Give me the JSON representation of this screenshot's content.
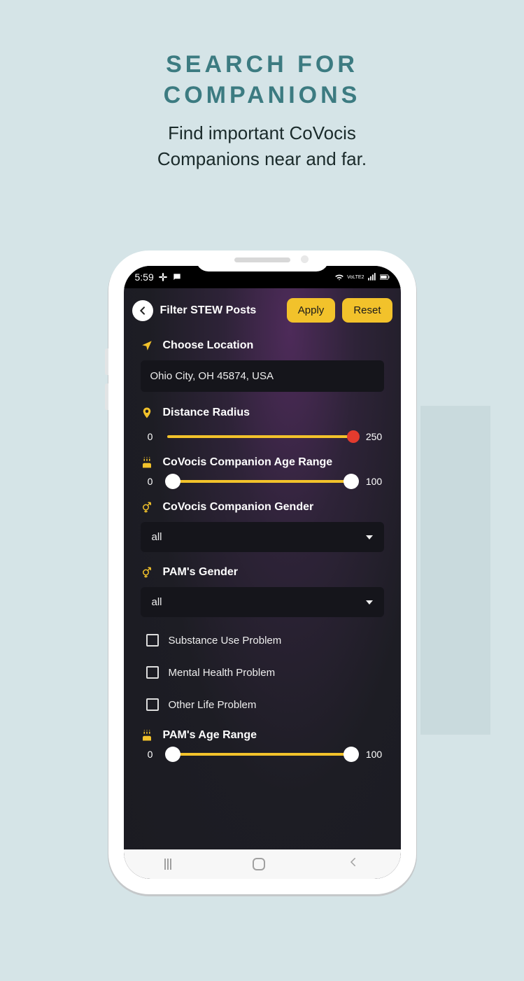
{
  "page": {
    "title_line1": "SEARCH FOR",
    "title_line2": "COMPANIONS",
    "subtitle_line1": "Find important CoVocis",
    "subtitle_line2": "Companions near and far."
  },
  "statusbar": {
    "time": "5:59",
    "carrier": "VoLTE2"
  },
  "appbar": {
    "title": "Filter STEW Posts",
    "apply": "Apply",
    "reset": "Reset"
  },
  "location": {
    "label": "Choose Location",
    "value": "Ohio City, OH 45874, USA"
  },
  "distance": {
    "label": "Distance Radius",
    "min": "0",
    "max": "250",
    "value": 250
  },
  "companion_age": {
    "label": "CoVocis Companion Age Range",
    "min": "0",
    "max": "100",
    "low": 0,
    "high": 100
  },
  "companion_gender": {
    "label": "CoVocis Companion Gender",
    "value": "all"
  },
  "pam_gender": {
    "label": "PAM's Gender",
    "value": "all"
  },
  "checkboxes": {
    "substance": "Substance Use Problem",
    "mental": "Mental Health Problem",
    "other": "Other Life Problem"
  },
  "pam_age": {
    "label": "PAM's Age Range",
    "min": "0",
    "max": "100",
    "low": 0,
    "high": 100
  }
}
